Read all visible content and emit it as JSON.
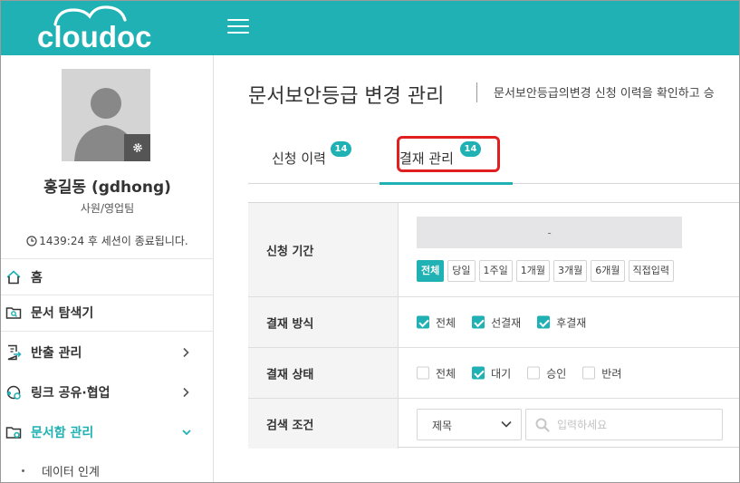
{
  "app": {
    "logo_text": "cloudoc",
    "brand_color": "#1fb1b3",
    "highlight_color": "#e02020"
  },
  "user": {
    "name": "홍길동 (gdhong)",
    "dept": "사원/영업팀",
    "session_text": "1439:24 후 세션이 종료됩니다."
  },
  "sidebar": {
    "items": [
      {
        "label": "홈",
        "icon": "home-icon"
      },
      {
        "label": "문서 탐색기",
        "icon": "folder-search-icon"
      },
      {
        "label": "반출 관리",
        "icon": "export-doc-icon"
      },
      {
        "label": "링크 공유·협업",
        "icon": "share-link-icon"
      },
      {
        "label": "문서함 관리",
        "icon": "folder-settings-icon"
      }
    ],
    "subitems": [
      {
        "label": "데이터 인계"
      }
    ]
  },
  "main": {
    "title": "문서보안등급 변경 관리",
    "desc": "문서보안등급의변경 신청 이력을 확인하고 승",
    "tabs": [
      {
        "label": "신청 이력",
        "badge": "14"
      },
      {
        "label": "결재 관리",
        "badge": "14",
        "active": true
      }
    ]
  },
  "filter": {
    "period": {
      "label": "신청 기간",
      "range_value": "-",
      "buttons": [
        "전체",
        "당일",
        "1주일",
        "1개월",
        "3개월",
        "6개월",
        "직접입력"
      ],
      "active_button": "전체"
    },
    "method": {
      "label": "결재 방식",
      "options": [
        {
          "label": "전체",
          "checked": true
        },
        {
          "label": "선결재",
          "checked": true
        },
        {
          "label": "후결재",
          "checked": true
        }
      ]
    },
    "status": {
      "label": "결재 상태",
      "options": [
        {
          "label": "전체",
          "checked": false
        },
        {
          "label": "대기",
          "checked": true
        },
        {
          "label": "승인",
          "checked": false
        },
        {
          "label": "반려",
          "checked": false
        }
      ]
    },
    "search": {
      "label": "검색 조건",
      "select_value": "제목",
      "placeholder": "입력하세요"
    }
  }
}
